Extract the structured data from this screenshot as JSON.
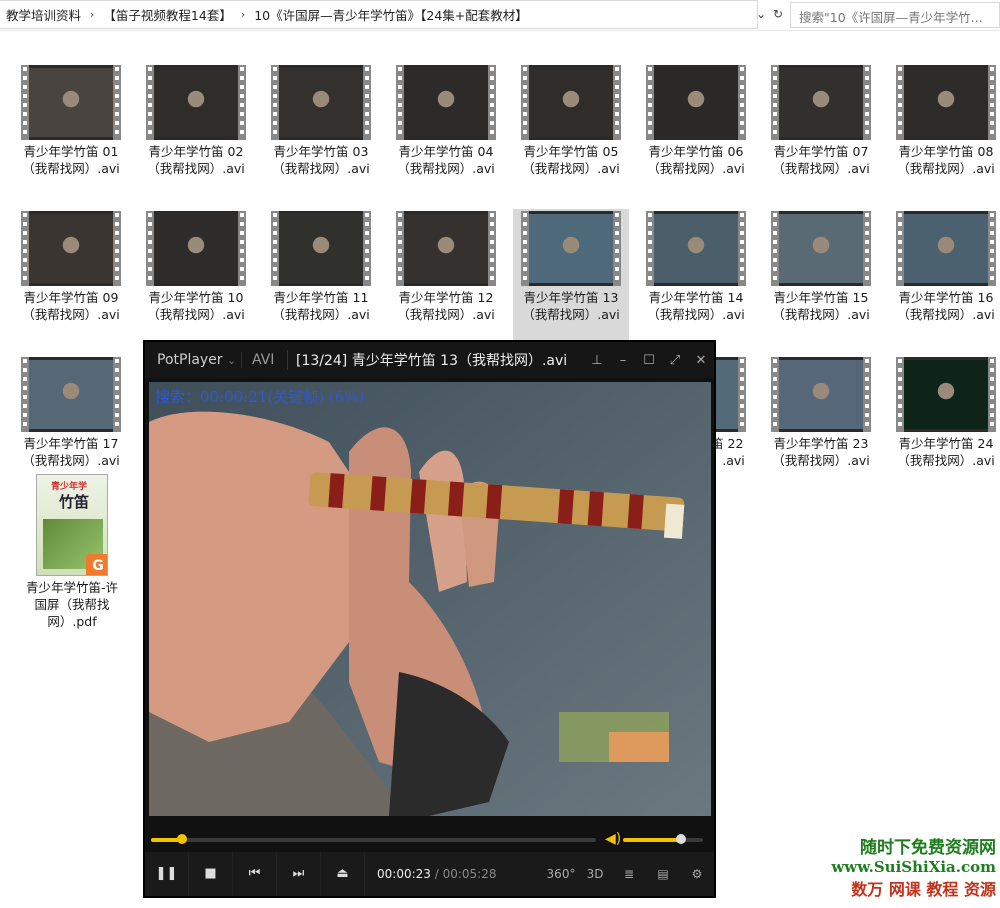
{
  "explorer": {
    "breadcrumbs": [
      "教学培训资料",
      "【笛子视频教程14套】",
      "10《许国屏—青少年学竹笛》【24集+配套教材】"
    ],
    "search_placeholder": "搜索\"10《许国屏—青少年学竹...",
    "files": [
      {
        "line1": "青少年学竹笛 01",
        "line2": "（我帮找网）.avi"
      },
      {
        "line1": "青少年学竹笛 02",
        "line2": "（我帮找网）.avi"
      },
      {
        "line1": "青少年学竹笛 03",
        "line2": "（我帮找网）.avi"
      },
      {
        "line1": "青少年学竹笛 04",
        "line2": "（我帮找网）.avi"
      },
      {
        "line1": "青少年学竹笛 05",
        "line2": "（我帮找网）.avi"
      },
      {
        "line1": "青少年学竹笛 06",
        "line2": "（我帮找网）.avi"
      },
      {
        "line1": "青少年学竹笛 07",
        "line2": "（我帮找网）.avi"
      },
      {
        "line1": "青少年学竹笛 08",
        "line2": "（我帮找网）.avi"
      },
      {
        "line1": "青少年学竹笛 09",
        "line2": "（我帮找网）.avi"
      },
      {
        "line1": "青少年学竹笛 10",
        "line2": "（我帮找网）.avi"
      },
      {
        "line1": "青少年学竹笛 11",
        "line2": "（我帮找网）.avi"
      },
      {
        "line1": "青少年学竹笛 12",
        "line2": "（我帮找网）.avi"
      },
      {
        "line1": "青少年学竹笛 13",
        "line2": "（我帮找网）.avi"
      },
      {
        "line1": "青少年学竹笛 14",
        "line2": "（我帮找网）.avi"
      },
      {
        "line1": "青少年学竹笛 15",
        "line2": "（我帮找网）.avi"
      },
      {
        "line1": "青少年学竹笛 16",
        "line2": "（我帮找网）.avi"
      },
      {
        "line1": "青少年学竹笛 17",
        "line2": "（我帮找网）.avi"
      },
      {
        "line1": "青少年学竹笛 22",
        "line2": "（我帮找网）.avi"
      },
      {
        "line1": "青少年学竹笛 23",
        "line2": "（我帮找网）.avi"
      },
      {
        "line1": "青少年学竹笛 24",
        "line2": "（我帮找网）.avi"
      }
    ],
    "selected_file": "青少年学竹笛 13",
    "pdf": {
      "line1": "青少年学竹笛-许",
      "line2": "国屏（我帮找",
      "line3": "网）.pdf",
      "cover_title": "竹笛"
    }
  },
  "player": {
    "brand": "PotPlayer",
    "format": "AVI",
    "title": "[13/24] 青少年学竹笛 13（我帮找网）.avi",
    "osd": "搜索：00:00:21(关键帧) (6%)",
    "current_time": "00:00:23",
    "duration": "00:05:28",
    "progress": 0.07,
    "volume": 0.73,
    "btn_360": "360°",
    "btn_3d": "3D"
  },
  "watermark": {
    "line1": "随时下免费资源网",
    "line2": "www.SuiShiXia.com",
    "line3": "数万 网课 教程 资源"
  },
  "colors": {
    "seek": "#f2c200",
    "osd": "#2d58d6",
    "selection": "#d9d9d9"
  }
}
